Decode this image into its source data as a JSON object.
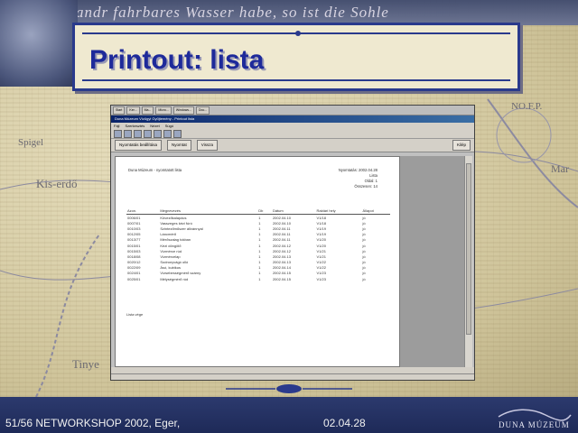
{
  "slide": {
    "banner_text": "andr fahrbares Wasser habe, so ist die Sohle",
    "title": "Printout: lista",
    "map_labels": [
      "Spigel",
      "Kis-erdő",
      "Tinye",
      "Mar",
      "NO.F.P."
    ],
    "footer_left": "51/56 NETWORKSHOP 2002, Eger,",
    "footer_date": "02.04.28",
    "logo_text": "DUNA MÚZEUM"
  },
  "window": {
    "taskbar_items": [
      "Start",
      "Ker...",
      "Ma...",
      "Micro...",
      "Windows...",
      "Doc..."
    ],
    "title": "Duna Múzeum Vízügyi Gyűjtemény - Printout lista",
    "menu": [
      "Fájl",
      "Szerkesztés",
      "Nézet",
      "Súgó"
    ],
    "nav_buttons": [
      "Nyomtatás beállítása",
      "Nyomtat",
      "Vissza"
    ],
    "nav_right_button": "Kilép"
  },
  "report": {
    "header_left": "Duna Múzeum - nyomtatott lista",
    "header_right": [
      "Nyomtatás: 2002.04.28",
      "Lista",
      "Oldal: 1",
      "Összesen: 14"
    ],
    "columns": [
      "Azon.",
      "Megnevezés",
      "Db",
      "Dátum",
      "Raktári hely",
      "Állapot"
    ],
    "rows": [
      [
        "0006/01",
        "Kövezőkalapács",
        "1",
        "2002.04.10",
        "V1/18",
        "jó"
      ],
      [
        "0007/01",
        "Vasszeges kézi fúró",
        "1",
        "2002.04.10",
        "V1/18",
        "jó"
      ],
      [
        "0010/03",
        "Szintezőműszer állvánnyal",
        "1",
        "2002.04.11",
        "V1/19",
        "jó"
      ],
      [
        "0012/05",
        "Láncmérő",
        "1",
        "2002.04.11",
        "V1/19",
        "jó"
      ],
      [
        "0013/77",
        "Mérőszalag tokban",
        "1",
        "2002.04.11",
        "V1/20",
        "jó"
      ],
      [
        "0015/01",
        "Kézi döngölő",
        "1",
        "2002.04.12",
        "V1/20",
        "jó"
      ],
      [
        "0015/03",
        "Vízmérce rúd",
        "1",
        "2002.04.12",
        "V1/21",
        "jó"
      ],
      [
        "0018/08",
        "Vízmércelap",
        "1",
        "2002.04.13",
        "V1/21",
        "jó"
      ],
      [
        "0020/12",
        "Sodronyvágó olló",
        "1",
        "2002.04.13",
        "V1/22",
        "jó"
      ],
      [
        "0022/09",
        "Ásó, kubikus",
        "1",
        "2002.04.14",
        "V1/22",
        "jó"
      ],
      [
        "0024/01",
        "Vízsebességmérő szárny",
        "1",
        "2002.04.15",
        "V1/23",
        "jó"
      ],
      [
        "0025/01",
        "Mélységmérő rúd",
        "1",
        "2002.04.15",
        "V1/23",
        "jó"
      ]
    ],
    "footer": "Lista vége"
  }
}
